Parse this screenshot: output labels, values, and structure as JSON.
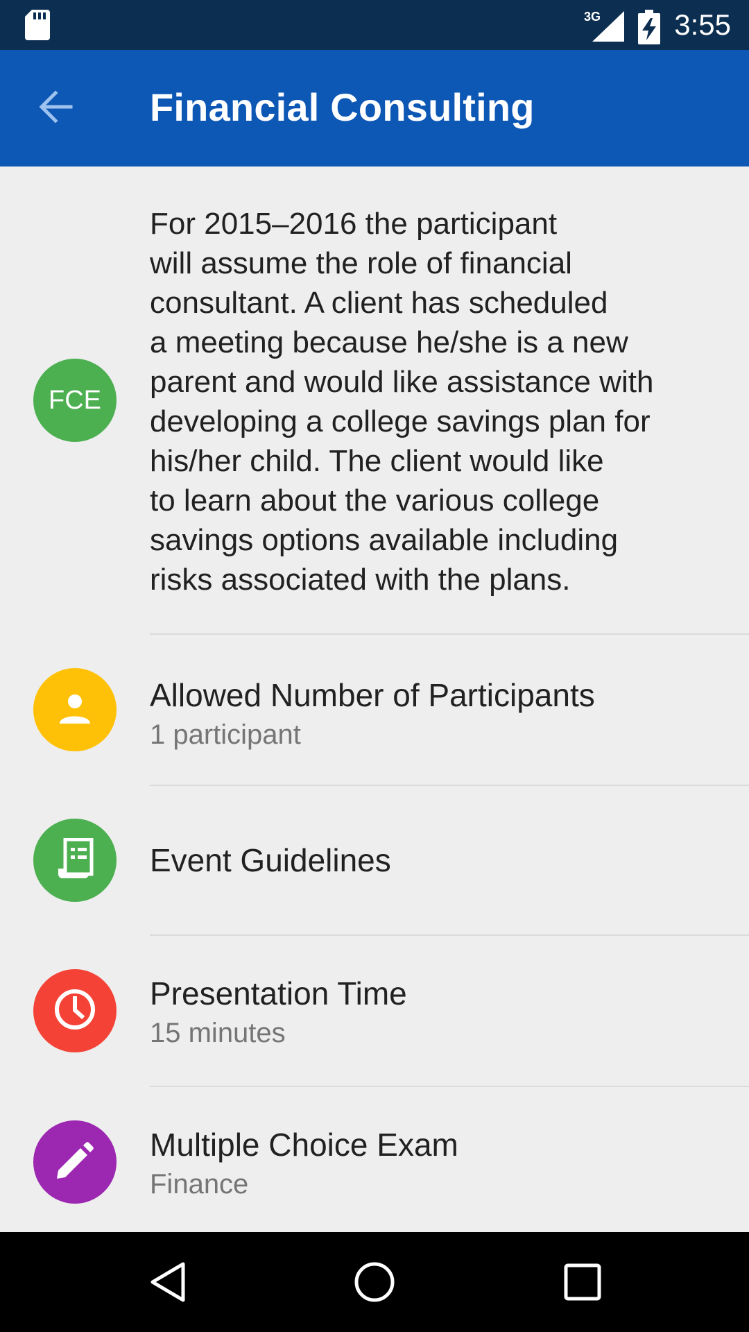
{
  "status_bar": {
    "network": "3G",
    "time": "3:55",
    "icons": [
      "sd-card-icon",
      "signal-icon",
      "battery-charging-icon"
    ]
  },
  "app_bar": {
    "title": "Financial Consulting",
    "back_icon": "arrow-back-icon",
    "color": "#0d57b5"
  },
  "event": {
    "badge": "FCE",
    "badge_color": "#4caf50",
    "description": "For 2015–2016 the participant\nwill assume the role of financial\nconsultant. A client has scheduled\na meeting  because he/she is a new\nparent and would like assistance with\ndeveloping a college savings plan for\nhis/her child. The client would like\nto learn about the various college\nsavings options available including\nrisks associated with the plans."
  },
  "details": [
    {
      "title": "Allowed Number of Participants",
      "subtitle": "1 participant",
      "icon": "person-icon",
      "color": "#ffc107"
    },
    {
      "title": "Event Guidelines",
      "subtitle": "",
      "icon": "document-icon",
      "color": "#4caf50"
    },
    {
      "title": "Presentation Time",
      "subtitle": "15 minutes",
      "icon": "clock-icon",
      "color": "#f44336"
    },
    {
      "title": "Multiple Choice Exam",
      "subtitle": "Finance",
      "icon": "pencil-icon",
      "color": "#9c27b0"
    }
  ],
  "nav_bar": {
    "buttons": [
      "back-triangle-icon",
      "home-circle-icon",
      "recents-square-icon"
    ]
  }
}
